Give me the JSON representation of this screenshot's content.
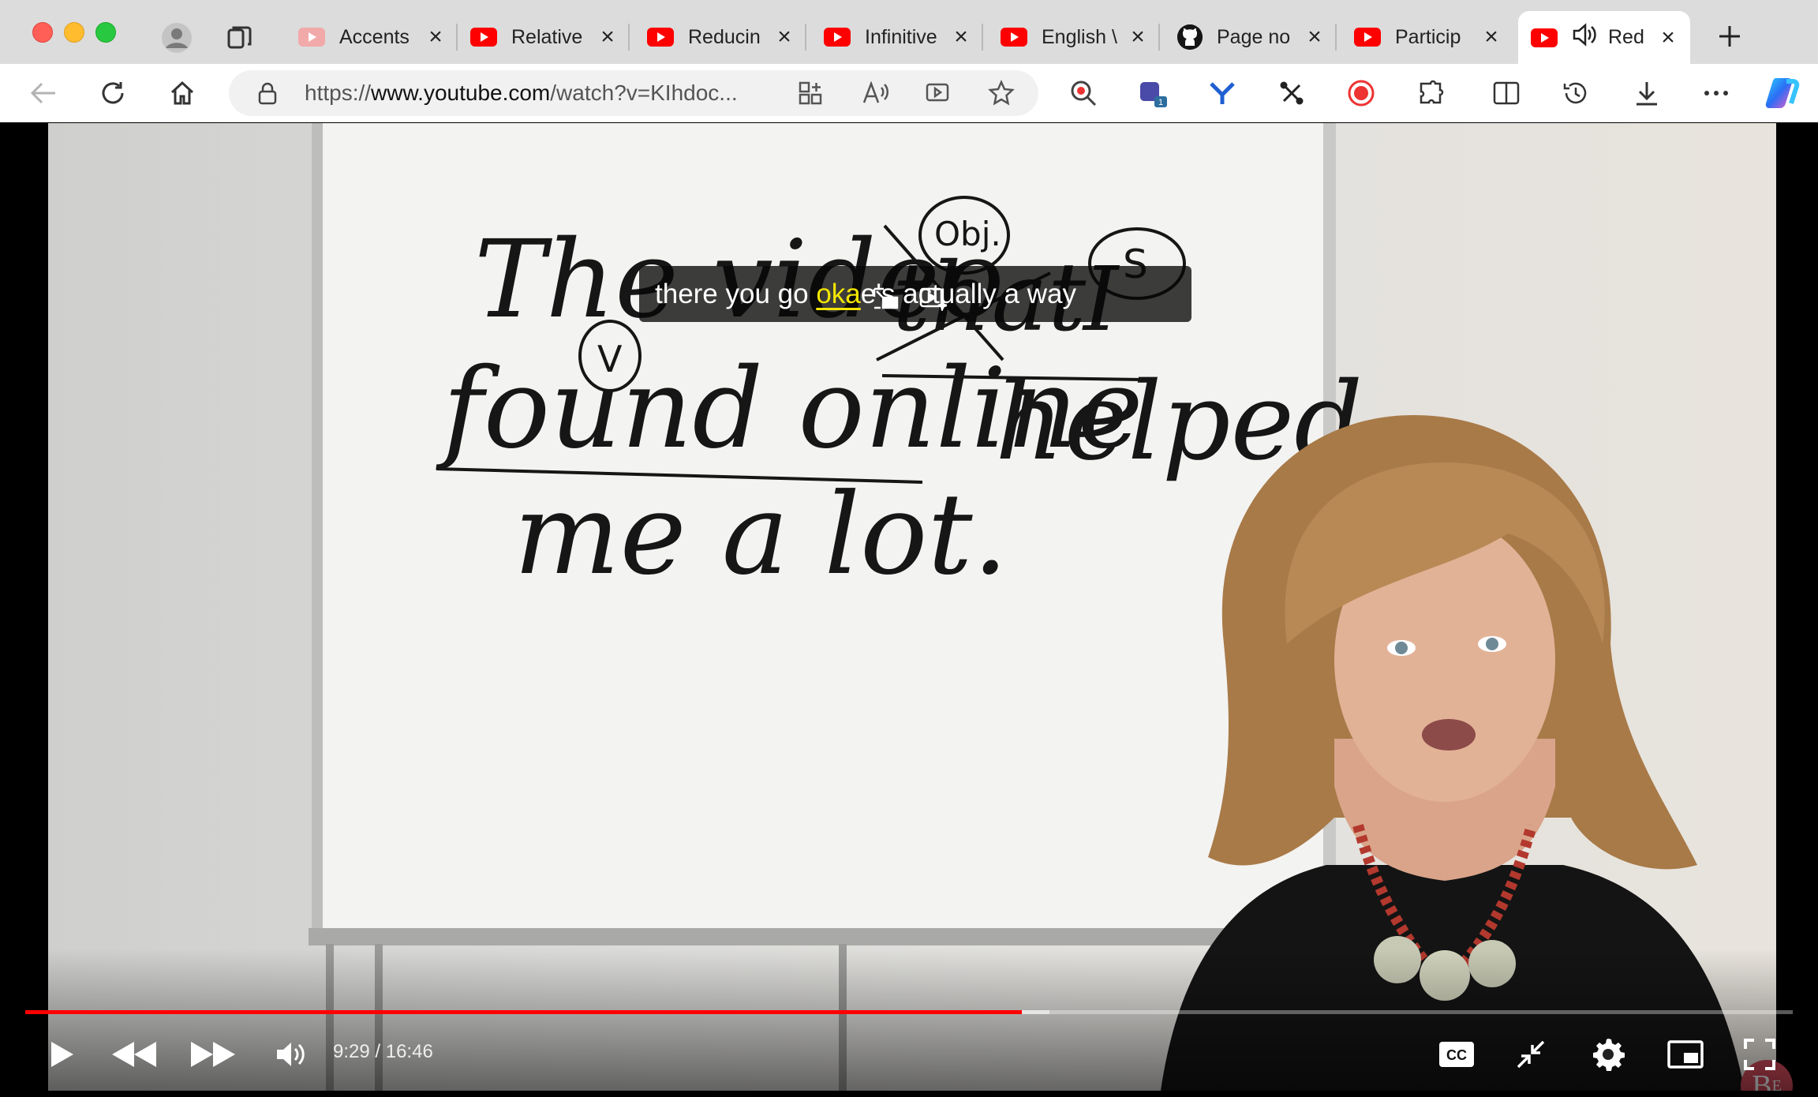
{
  "browser": {
    "tabs": [
      {
        "label": "Accents",
        "favicon": "youtube-muted"
      },
      {
        "label": "Relative",
        "favicon": "youtube"
      },
      {
        "label": "Reducin",
        "favicon": "youtube"
      },
      {
        "label": "Infinitive",
        "favicon": "youtube"
      },
      {
        "label": "English \\",
        "favicon": "youtube"
      },
      {
        "label": "Page no",
        "favicon": "github"
      },
      {
        "label": "Particip",
        "favicon": "youtube"
      },
      {
        "label": "Red",
        "favicon": "youtube",
        "active": true,
        "audio": true
      }
    ],
    "address": {
      "scheme": "https://",
      "host": "www.youtube.com",
      "path": "/watch?v=KIhdoc..."
    },
    "extension_badge": "1"
  },
  "video": {
    "caption": {
      "before": "there you go  ",
      "highlight": "oka",
      "after": "e's actually a way"
    },
    "board_text": {
      "line1": "The video",
      "struck": "that",
      "pronoun": "I",
      "line2a": "found online",
      "line2b": "helped",
      "line3": "me a lot.",
      "circle_obj": "Obj.",
      "circle_s": "S",
      "circle_v": "V"
    },
    "watermark": "B",
    "watermark_sup": "E",
    "time": {
      "current": "9:29",
      "sep": " / ",
      "total": "16:46"
    },
    "progress": {
      "played_fraction": 0.5638,
      "buffered_fraction": 0.5794
    }
  },
  "colors": {
    "youtube_red": "#ff0000",
    "caption_highlight": "#f3e600",
    "tabstrip": "#dcdcdc"
  }
}
